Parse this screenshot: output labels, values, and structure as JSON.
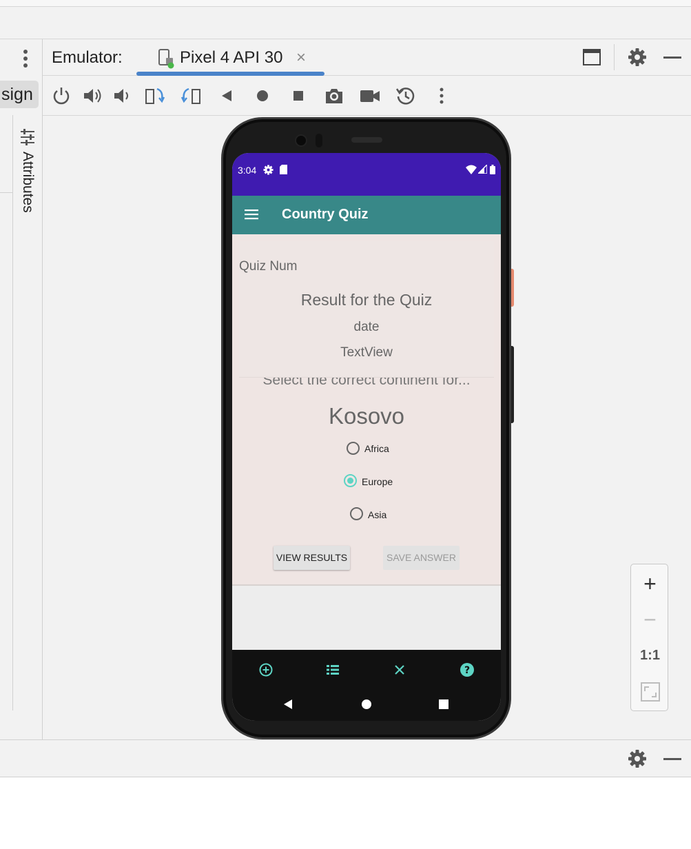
{
  "ide": {
    "design_tab_label": "sign",
    "attributes_label": "Attributes",
    "emulator_label": "Emulator:",
    "device_tab_label": "Pixel 4 API 30",
    "device_tab_close": "×",
    "controls": [
      "power-icon",
      "volume-up-icon",
      "volume-down-icon",
      "rotate-left-icon",
      "rotate-right-icon",
      "back-icon",
      "home-icon",
      "overview-icon",
      "camera-icon",
      "video-icon",
      "snapshot-icon",
      "more-icon"
    ],
    "zoom": {
      "zoom_in": "+",
      "zoom_out": "−",
      "actual_size": "1:1"
    },
    "accent_color": "#4a83c9"
  },
  "phone": {
    "status_bar": {
      "time": "3:04",
      "color": "#3f1bb0"
    },
    "app_bar": {
      "title": "Country Quiz",
      "color": "#388888"
    },
    "result": {
      "quiz_num": "Quiz Num",
      "title": "Result for the Quiz",
      "date": "date",
      "textview": "TextView"
    },
    "question": {
      "prompt": "Select the correct continent for...",
      "country": "Kosovo",
      "options": [
        {
          "label": "Africa",
          "checked": false
        },
        {
          "label": "Europe",
          "checked": true
        },
        {
          "label": "Asia",
          "checked": false
        }
      ]
    },
    "buttons": {
      "view_results": "VIEW RESULTS",
      "save_answer": "SAVE ANSWER"
    },
    "bottom_nav": [
      "add-circle-icon",
      "list-icon",
      "close-icon",
      "help-icon"
    ],
    "accent_teal": "#5dd4c4"
  }
}
